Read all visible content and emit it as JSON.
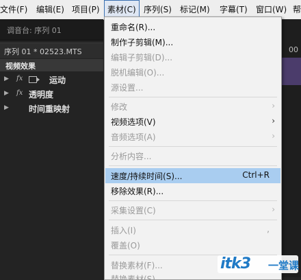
{
  "menubar": {
    "items": [
      {
        "label": "文件(F)"
      },
      {
        "label": "编辑(E)"
      },
      {
        "label": "项目(P)"
      },
      {
        "label": "素材(C)"
      },
      {
        "label": "序列(S)"
      },
      {
        "label": "标记(M)"
      },
      {
        "label": "字幕(T)"
      },
      {
        "label": "窗口(W)"
      },
      {
        "label": "帮"
      }
    ]
  },
  "left_panel": {
    "title": "调音台: 序列 01",
    "sequence_tab": "序列 01 * 02523.MTS",
    "effects_heading": "视频效果",
    "effects": [
      {
        "fx": "fx",
        "name": "运动"
      },
      {
        "fx": "fx",
        "name": "透明度"
      },
      {
        "fx": "",
        "name": "时间重映射"
      }
    ]
  },
  "right_panel": {
    "timecode": "00"
  },
  "dropdown": {
    "items": [
      {
        "label": "重命名(R)...",
        "disabled": false
      },
      {
        "label": "制作子剪辑(M)...",
        "disabled": false
      },
      {
        "label": "编辑子剪辑(D)...",
        "disabled": true
      },
      {
        "label": "脱机编辑(O)...",
        "disabled": true
      },
      {
        "label": "源设置...",
        "disabled": true
      },
      {
        "label": "修改",
        "disabled": true,
        "submenu": true
      },
      {
        "label": "视频选项(V)",
        "disabled": false,
        "submenu": true
      },
      {
        "label": "音频选项(A)",
        "disabled": true,
        "submenu": true
      },
      {
        "label": "分析内容...",
        "disabled": true
      },
      {
        "label": "速度/持续时间(S)...",
        "shortcut": "Ctrl+R",
        "highlighted": true
      },
      {
        "label": "移除效果(R)...",
        "disabled": false
      },
      {
        "label": "采集设置(C)",
        "disabled": true,
        "submenu": true
      },
      {
        "label": "插入(I)",
        "disabled": true,
        "suffix": ","
      },
      {
        "label": "覆盖(O)",
        "disabled": true
      },
      {
        "label": "替换素材(F)...",
        "disabled": true
      },
      {
        "label": "替换素材(S)",
        "disabled": true
      }
    ],
    "arrow_glyph": "›"
  },
  "watermark": {
    "text": "itk3",
    "suffix": "一堂课"
  }
}
